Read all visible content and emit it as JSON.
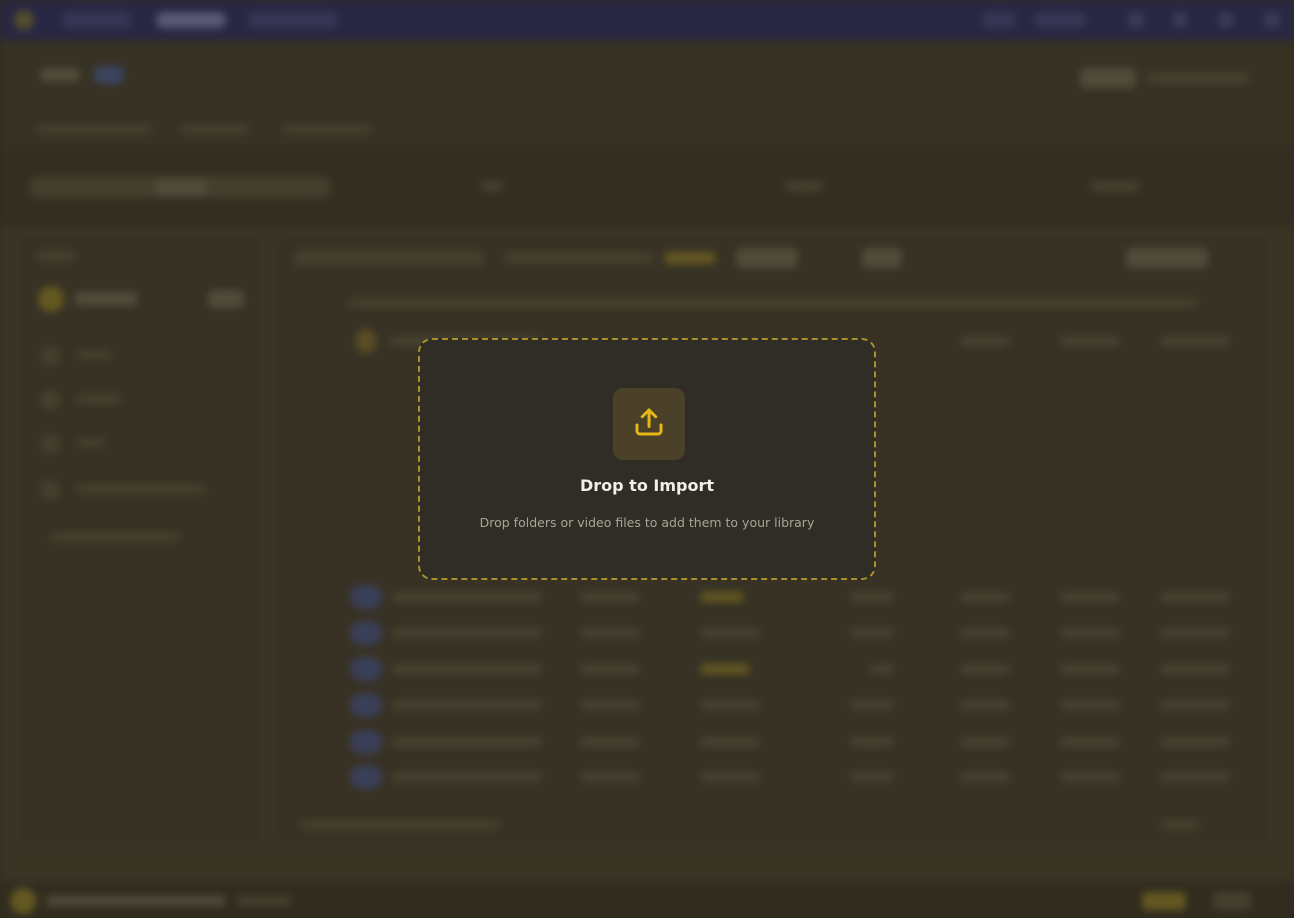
{
  "drop_zone": {
    "icon": "upload-icon",
    "title": "Drop to Import",
    "subtitle": "Drop folders or video files to add them to your library"
  },
  "colors": {
    "accent": "#e8b717",
    "overlay_panel": "#302d26",
    "dashed_border": "#a8912a",
    "top_bar": "#2f2f5e"
  }
}
